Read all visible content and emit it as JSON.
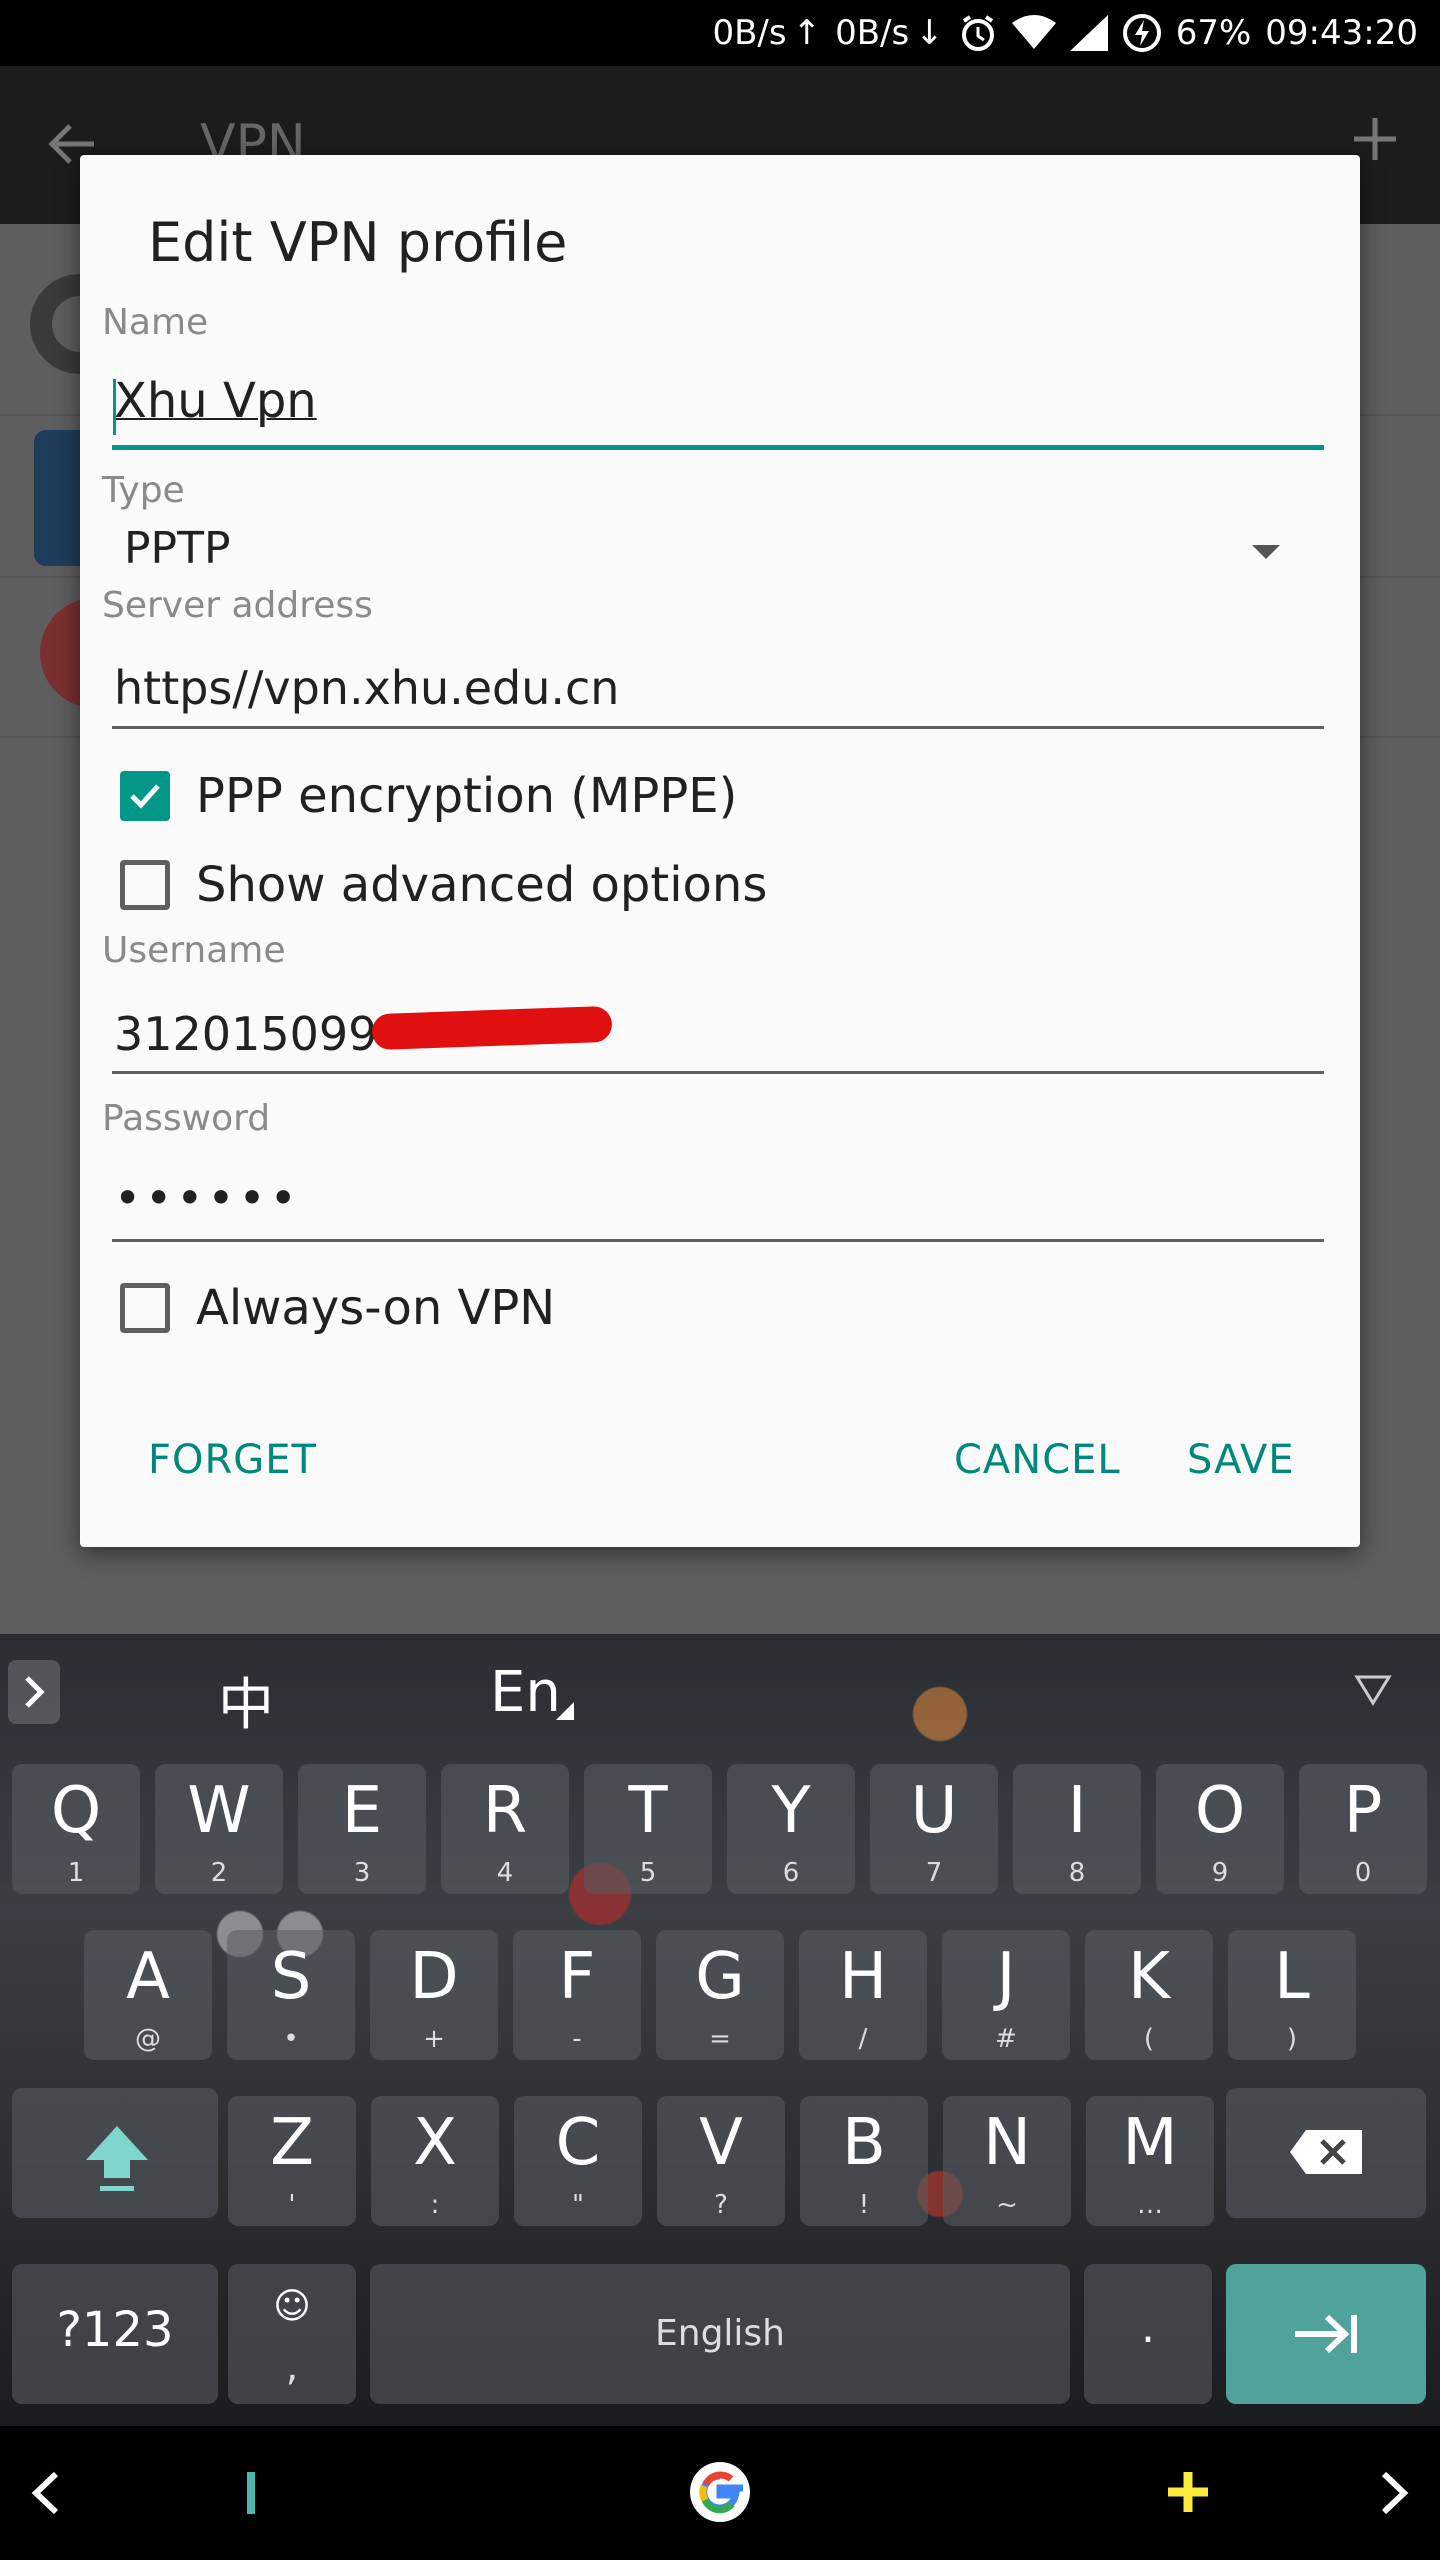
{
  "status_bar": {
    "net_up": "0B/s",
    "net_down": "0B/s",
    "battery": "67%",
    "time": "09:43:20"
  },
  "background": {
    "title": "VPN"
  },
  "dialog": {
    "title": "Edit VPN profile",
    "name_label": "Name",
    "name_value": "Xhu Vpn",
    "type_label": "Type",
    "type_value": "PPTP",
    "server_label": "Server address",
    "server_value": "https//vpn.xhu.edu.cn",
    "ppp_encryption_label": "PPP encryption (MPPE)",
    "ppp_encryption_checked": true,
    "show_advanced_label": "Show advanced options",
    "show_advanced_checked": false,
    "username_label": "Username",
    "username_value": "312015099",
    "password_label": "Password",
    "password_value": "••••••",
    "always_on_label": "Always-on VPN",
    "always_on_checked": false,
    "forget_button": "FORGET",
    "cancel_button": "CANCEL",
    "save_button": "SAVE"
  },
  "keyboard": {
    "lang_chinese": "中",
    "lang_english": "En",
    "row1": [
      {
        "main": "Q",
        "sub": "1"
      },
      {
        "main": "W",
        "sub": "2"
      },
      {
        "main": "E",
        "sub": "3"
      },
      {
        "main": "R",
        "sub": "4"
      },
      {
        "main": "T",
        "sub": "5"
      },
      {
        "main": "Y",
        "sub": "6"
      },
      {
        "main": "U",
        "sub": "7"
      },
      {
        "main": "I",
        "sub": "8"
      },
      {
        "main": "O",
        "sub": "9"
      },
      {
        "main": "P",
        "sub": "0"
      }
    ],
    "row2": [
      {
        "main": "A",
        "sub": "@"
      },
      {
        "main": "S",
        "sub": "•"
      },
      {
        "main": "D",
        "sub": "+"
      },
      {
        "main": "F",
        "sub": "-"
      },
      {
        "main": "G",
        "sub": "="
      },
      {
        "main": "H",
        "sub": "/"
      },
      {
        "main": "J",
        "sub": "#"
      },
      {
        "main": "K",
        "sub": "("
      },
      {
        "main": "L",
        "sub": ")"
      }
    ],
    "row3": [
      {
        "main": "Z",
        "sub": "'"
      },
      {
        "main": "X",
        "sub": ":"
      },
      {
        "main": "C",
        "sub": "\""
      },
      {
        "main": "V",
        "sub": "?"
      },
      {
        "main": "B",
        "sub": "!"
      },
      {
        "main": "N",
        "sub": "~"
      },
      {
        "main": "M",
        "sub": "…"
      }
    ],
    "symbols_key": "?123",
    "emoji_key": "☺",
    "comma_key": ",",
    "space_label": "English",
    "period_key": "."
  },
  "colors": {
    "accent": "#009688",
    "button_text": "#00897b",
    "enter_key": "#4fa39a"
  }
}
